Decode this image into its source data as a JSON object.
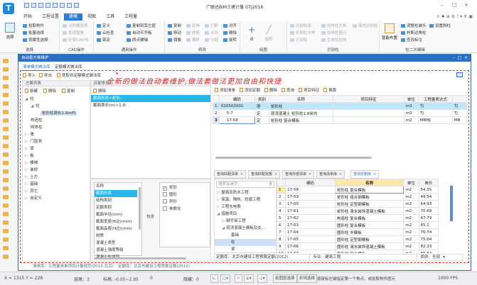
{
  "app": {
    "title": "广联达BIM土建计量 GTJ2018",
    "logo": "T"
  },
  "menu_tabs": [
    "开始",
    "工程设置",
    "建模",
    "视图",
    "工具",
    "工程量"
  ],
  "active_menu_tab": "建模",
  "ribbon": {
    "select": {
      "label": "选择",
      "big": "选择",
      "items": [
        "拾取构件",
        "批量选择",
        "按属性选择"
      ]
    },
    "cad": {
      "label": "CAD操作",
      "items": [
        "识别楼层表",
        "查找替换",
        "还原CAD线"
      ]
    },
    "common": {
      "label": "通用操作",
      "items": [
        "定义",
        "云检查",
        "锁定",
        "复制到其它层",
        "自动平齐板",
        "两点辅轴"
      ]
    },
    "modify": {
      "label": "修改",
      "items": [
        "复制",
        "移动",
        "镜像",
        "延伸",
        "修剪",
        "偏移",
        "打断",
        "合并",
        "分割",
        "对齐",
        "删除",
        "旋转"
      ]
    },
    "draw": {
      "label": "绘图",
      "items": [
        "点",
        "旋转"
      ]
    },
    "identify": {
      "label": "识别柱",
      "items": [
        "识别柱表",
        "识别柱大样",
        "识别柱",
        "校核柱大样",
        "校核柱图元",
        "生成柱边线",
        "填充识别柱"
      ]
    },
    "edit2": {
      "label": "柱二次编辑",
      "big": "智能布置",
      "items": [
        "调整柱端头",
        "判断边角柱",
        "查改标注",
        "设置斜柱"
      ]
    }
  },
  "dialog": {
    "title": "自动套方案维护",
    "tabs": [
      "清单模式做法库",
      "定额模式做法库"
    ],
    "active_tab": "清单模式做法库",
    "toolbar": [
      "导入",
      "导出",
      "提取到定额模式做法库"
    ],
    "annotation": "全新的做法自动套维护,做法套做法更加自由和快捷",
    "scheme_list": {
      "header": "方案列表",
      "toolbar": [
        "新建",
        "删除",
        "复制"
      ],
      "tree": [
        {
          "label": "柱",
          "level": 0,
          "expanded": true
        },
        {
          "label": "柱",
          "level": 1,
          "expanded": true
        },
        {
          "label": "矩形柱周长1.8m内",
          "level": 2,
          "selected": true
        },
        {
          "label": "构造柱",
          "level": 1
        },
        {
          "label": "砌体柱",
          "level": 1
        },
        {
          "label": "墙",
          "level": 0
        },
        {
          "label": "门窗洞",
          "level": 0
        },
        {
          "label": "梁",
          "level": 0
        },
        {
          "label": "板",
          "level": 0
        },
        {
          "label": "楼梯",
          "level": 0
        },
        {
          "label": "装修",
          "level": 0
        },
        {
          "label": "土方",
          "level": 0
        },
        {
          "label": "基础",
          "level": 0
        },
        {
          "label": "其它",
          "level": 0
        },
        {
          "label": "自定义",
          "level": 0
        }
      ]
    },
    "match": {
      "header": "匹配条件",
      "delete": "删除",
      "conditions": [
        "截面形状=矩形;",
        "截面周长(m)<1.8;"
      ],
      "selected_condition": 0,
      "attr_header": "名称",
      "attrs": [
        "截面形状",
        "结构类别",
        "定额类别",
        "截面半径(mm)",
        "截面宽度(B边)(mm)",
        "截面高度(H边)(mm)",
        "材质",
        "混凝土类型",
        "混凝土强度等级",
        "混凝土外加剂"
      ],
      "selected_attr": 0,
      "operator": "包含",
      "values": [
        {
          "label": "矩形",
          "checked": true
        },
        {
          "label": "圆形",
          "checked": false
        },
        {
          "label": "异形",
          "checked": false
        },
        {
          "label": "参数化",
          "checked": false
        }
      ]
    },
    "bill": {
      "toolbar": [
        "添加清单",
        "添加定额",
        "删除",
        "查询",
        "项目特征",
        "换算"
      ],
      "columns": [
        "编码",
        "类别",
        "名称",
        "项目特征",
        "单位",
        "工程量表达式"
      ],
      "rows": [
        {
          "no": "1",
          "code": "010502001",
          "type": "项",
          "name": "矩形柱",
          "feature": "",
          "unit": "m3",
          "expr": "TJ",
          "extra": "TJ"
        },
        {
          "no": "2",
          "code": "5-7",
          "type": "定",
          "name": "现浇混凝土 矩形柱1.8米内",
          "feature": "",
          "unit": "m3",
          "expr": "TJ",
          "extra": "TJ"
        },
        {
          "no": "3",
          "code": "17-58",
          "type": "定",
          "name": "矩形柱 复合模板",
          "feature": "",
          "unit": "m2",
          "expr": "MBMJ",
          "extra": "MB"
        }
      ]
    },
    "query_tabs": [
      "查询匹配清单",
      "查询匹配定额",
      "查询外部清单",
      "查询清单库",
      "查询定额库"
    ],
    "active_query_tab": "查询定额库",
    "quota": {
      "search_placeholder": "搜索关键字...",
      "tree": [
        {
          "label": "屋面及防水工程",
          "level": 0,
          "arrow": "▷"
        },
        {
          "label": "保温、隔热、防腐工程",
          "level": 0,
          "arrow": "▷"
        },
        {
          "label": "工程水电费",
          "level": 0,
          "arrow": "▷"
        },
        {
          "label": "措施项目",
          "level": 0,
          "arrow": "◢"
        },
        {
          "label": "脚手架工程",
          "level": 1,
          "arrow": "▷"
        },
        {
          "label": "现浇混凝土模板及支...",
          "level": 1,
          "arrow": "◢"
        },
        {
          "label": "基础",
          "level": 2,
          "arrow": ""
        },
        {
          "label": "柱",
          "level": 2,
          "arrow": "",
          "selected": true
        },
        {
          "label": "梁",
          "level": 2,
          "arrow": ""
        }
      ],
      "columns": [
        "编码",
        "名称",
        "单位",
        "单价"
      ],
      "rows": [
        [
          "1",
          "17-58",
          "矩形柱 复合模板",
          "m2",
          "54.35"
        ],
        [
          "2",
          "17-59",
          "矩形柱 组合钢模板",
          "m2",
          "49.54"
        ],
        [
          "3",
          "17-60",
          "矩形柱 定型钢模板",
          "m2",
          "64.93"
        ],
        [
          "4",
          "17-61",
          "矩形柱 清水装饰混凝土模板",
          "m2",
          "70.69"
        ],
        [
          "5",
          "17-62",
          "构造柱 复合模板",
          "m2",
          "47.79"
        ],
        [
          "6",
          "17-63",
          "圆形柱 复合模板",
          "m2",
          "65.1"
        ],
        [
          "7",
          "17-64",
          "圆形柱 木模板",
          "m2",
          "76.74"
        ],
        [
          "8",
          "17-65",
          "圆形柱 定型钢模板",
          "m2",
          "75.64"
        ],
        [
          "9",
          "17-66",
          "圆形柱 清水装饰混凝土模板",
          "m2",
          "82.33"
        ],
        [
          "10",
          "17-67",
          "异形柱 复合模板",
          "m2",
          "66.54"
        ]
      ],
      "quota_lib_label": "定额库:",
      "quota_lib": "北京市建设工程预算定额(2012)",
      "major_label": "专业:",
      "major": "建筑工程",
      "category_label": "类别:",
      "category": "全部"
    },
    "footer": {
      "bill_lib": "清单库：工程量清单项目计量规范(2013-北京)",
      "quota_lib": "定额库：北京市建设工程预算定额(2012)"
    }
  },
  "statusbar": {
    "coords": "X = 1315 Y = 228",
    "floor_height": "层高：3",
    "elevation": "标高: -0.05~2.95",
    "zero": "0",
    "hidden": "隐藏：0",
    "layer_select": "拾图层选择",
    "polyline_select": "折线选择",
    "hint": "按鼠标左键指定第一个角点，或拾取构件图元",
    "fps": "1000 FPS"
  },
  "colors": {
    "accent": "#2b6fc4",
    "highlight": "#29b6e8",
    "annotation": "#d22222",
    "active_tab": "#2b7cd3"
  }
}
